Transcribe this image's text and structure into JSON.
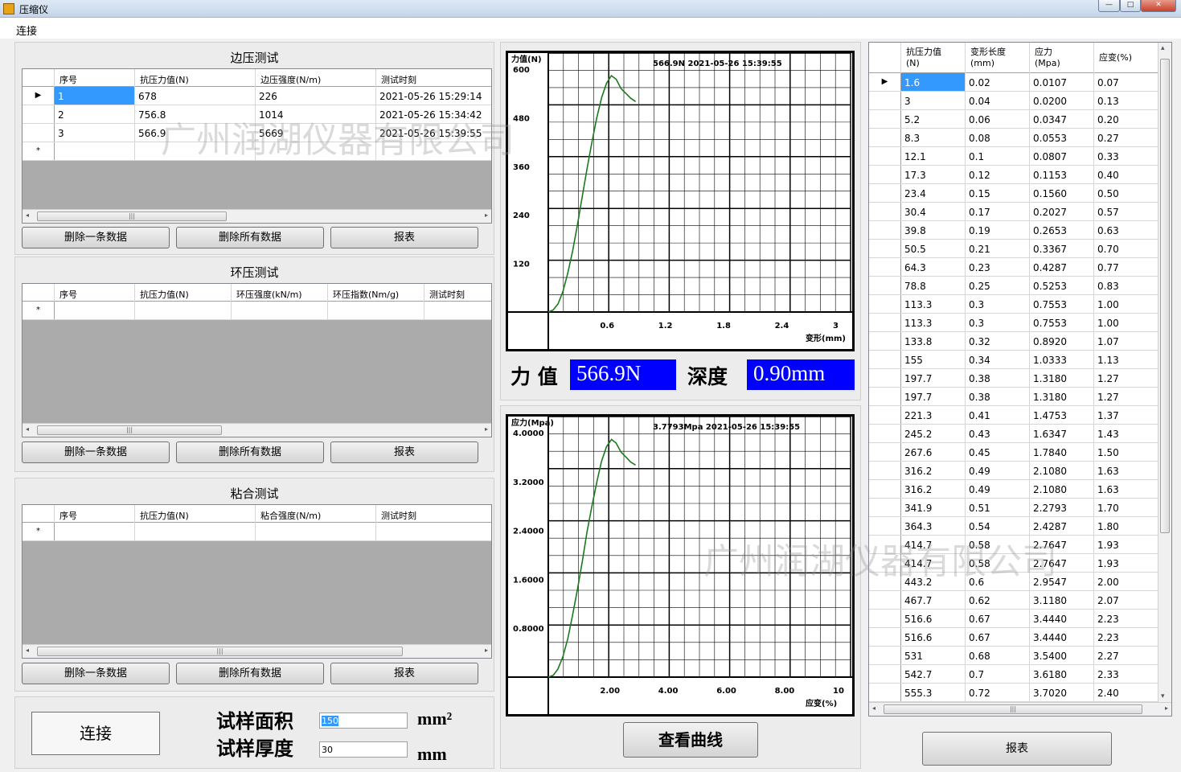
{
  "window": {
    "title": "压缩仪",
    "min_glyph": "—",
    "max_glyph": "□",
    "close_glyph": "✕"
  },
  "menu": {
    "connect": "连接"
  },
  "watermark": "广州润湖仪器有限公司",
  "edge": {
    "title": "边压测试",
    "columns": [
      "序号",
      "抗压力值(N)",
      "边压强度(N/m)",
      "测试时刻"
    ],
    "rows": [
      [
        "1",
        "678",
        "226",
        "2021-05-26 15:29:14"
      ],
      [
        "2",
        "756.8",
        "1014",
        "2021-05-26 15:34:42"
      ],
      [
        "3",
        "566.9",
        "5669",
        "2021-05-26 15:39:55"
      ]
    ]
  },
  "ring": {
    "title": "环压测试",
    "columns": [
      "序号",
      "抗压力值(N)",
      "环压强度(kN/m)",
      "环压指数(Nm/g)",
      "测试时刻"
    ]
  },
  "bond": {
    "title": "粘合测试",
    "columns": [
      "序号",
      "抗压力值(N)",
      "粘合强度(N/m)",
      "测试时刻"
    ]
  },
  "buttons": {
    "delete_one": "删除一条数据",
    "delete_all": "删除所有数据",
    "report": "报表",
    "connect": "连接",
    "view_curve": "查看曲线"
  },
  "sample": {
    "area_label": "试样面积",
    "area_value": "150",
    "area_unit": "mm²",
    "thickness_label": "试样厚度",
    "thickness_value": "30",
    "thickness_unit": "mm"
  },
  "force_display": {
    "force_label": "力 值",
    "force_value": "566.9N",
    "depth_label": "深度",
    "depth_value": "0.90mm"
  },
  "chart_data": [
    {
      "type": "line",
      "ylabel": "力值(N)",
      "xlabel": "变形(mm)",
      "annotation": "566.9N 2021-05-26 15:39:55",
      "yticks": [
        "600",
        "480",
        "360",
        "240",
        "120"
      ],
      "xticks": [
        "0.6",
        "1.2",
        "1.8",
        "2.4",
        "3"
      ],
      "xlim": [
        0,
        3
      ],
      "ylim": [
        0,
        600
      ],
      "grid": true,
      "x": [
        0,
        0.05,
        0.1,
        0.15,
        0.2,
        0.25,
        0.3,
        0.35,
        0.4,
        0.45,
        0.5,
        0.55,
        0.6,
        0.65,
        0.7,
        0.75,
        0.8,
        0.85,
        0.9
      ],
      "y": [
        0,
        5,
        20,
        50,
        95,
        150,
        215,
        285,
        355,
        420,
        480,
        530,
        565,
        584,
        575,
        552,
        540,
        528,
        520
      ],
      "color": "#1a7a1a"
    },
    {
      "type": "line",
      "ylabel": "应力(Mpa)",
      "xlabel": "应变(%)",
      "annotation": "3.7793Mpa 2021-05-26 15:39:55",
      "yticks": [
        "4.0000",
        "3.2000",
        "2.4000",
        "1.6000",
        "0.8000"
      ],
      "xticks": [
        "2.00",
        "4.00",
        "6.00",
        "8.00",
        "10"
      ],
      "xlim": [
        0,
        10
      ],
      "ylim": [
        0,
        4
      ],
      "grid": true,
      "x": [
        0,
        0.17,
        0.33,
        0.5,
        0.67,
        0.83,
        1.0,
        1.17,
        1.33,
        1.5,
        1.67,
        1.83,
        2.0,
        2.17,
        2.33,
        2.5,
        2.67,
        2.83,
        3.0
      ],
      "y": [
        0,
        0.03,
        0.13,
        0.33,
        0.63,
        1.0,
        1.43,
        1.9,
        2.37,
        2.8,
        3.2,
        3.53,
        3.77,
        3.89,
        3.83,
        3.68,
        3.6,
        3.52,
        3.47
      ],
      "color": "#1a7a1a"
    }
  ],
  "data_table": {
    "columns": [
      [
        "抗压力值",
        "(N)"
      ],
      [
        "变形长度",
        "(mm)"
      ],
      [
        "应力",
        "(Mpa)"
      ],
      [
        "应变(%)",
        ""
      ]
    ],
    "rows": [
      [
        "1.6",
        "0.02",
        "0.0107",
        "0.07"
      ],
      [
        "3",
        "0.04",
        "0.0200",
        "0.13"
      ],
      [
        "5.2",
        "0.06",
        "0.0347",
        "0.20"
      ],
      [
        "8.3",
        "0.08",
        "0.0553",
        "0.27"
      ],
      [
        "12.1",
        "0.1",
        "0.0807",
        "0.33"
      ],
      [
        "17.3",
        "0.12",
        "0.1153",
        "0.40"
      ],
      [
        "23.4",
        "0.15",
        "0.1560",
        "0.50"
      ],
      [
        "30.4",
        "0.17",
        "0.2027",
        "0.57"
      ],
      [
        "39.8",
        "0.19",
        "0.2653",
        "0.63"
      ],
      [
        "50.5",
        "0.21",
        "0.3367",
        "0.70"
      ],
      [
        "64.3",
        "0.23",
        "0.4287",
        "0.77"
      ],
      [
        "78.8",
        "0.25",
        "0.5253",
        "0.83"
      ],
      [
        "113.3",
        "0.3",
        "0.7553",
        "1.00"
      ],
      [
        "113.3",
        "0.3",
        "0.7553",
        "1.00"
      ],
      [
        "133.8",
        "0.32",
        "0.8920",
        "1.07"
      ],
      [
        "155",
        "0.34",
        "1.0333",
        "1.13"
      ],
      [
        "197.7",
        "0.38",
        "1.3180",
        "1.27"
      ],
      [
        "197.7",
        "0.38",
        "1.3180",
        "1.27"
      ],
      [
        "221.3",
        "0.41",
        "1.4753",
        "1.37"
      ],
      [
        "245.2",
        "0.43",
        "1.6347",
        "1.43"
      ],
      [
        "267.6",
        "0.45",
        "1.7840",
        "1.50"
      ],
      [
        "316.2",
        "0.49",
        "2.1080",
        "1.63"
      ],
      [
        "316.2",
        "0.49",
        "2.1080",
        "1.63"
      ],
      [
        "341.9",
        "0.51",
        "2.2793",
        "1.70"
      ],
      [
        "364.3",
        "0.54",
        "2.4287",
        "1.80"
      ],
      [
        "414.7",
        "0.58",
        "2.7647",
        "1.93"
      ],
      [
        "414.7",
        "0.58",
        "2.7647",
        "1.93"
      ],
      [
        "443.2",
        "0.6",
        "2.9547",
        "2.00"
      ],
      [
        "467.7",
        "0.62",
        "3.1180",
        "2.07"
      ],
      [
        "516.6",
        "0.67",
        "3.4440",
        "2.23"
      ],
      [
        "516.6",
        "0.67",
        "3.4440",
        "2.23"
      ],
      [
        "531",
        "0.68",
        "3.5400",
        "2.27"
      ],
      [
        "542.7",
        "0.7",
        "3.6180",
        "2.33"
      ],
      [
        "555.3",
        "0.72",
        "3.7020",
        "2.40"
      ]
    ]
  },
  "icons": {
    "row_pointer": "▶",
    "new_row": "*",
    "scroll_left": "◂",
    "scroll_right": "▸",
    "scroll_up": "▴",
    "scroll_down": "▾",
    "grip": "|||"
  }
}
